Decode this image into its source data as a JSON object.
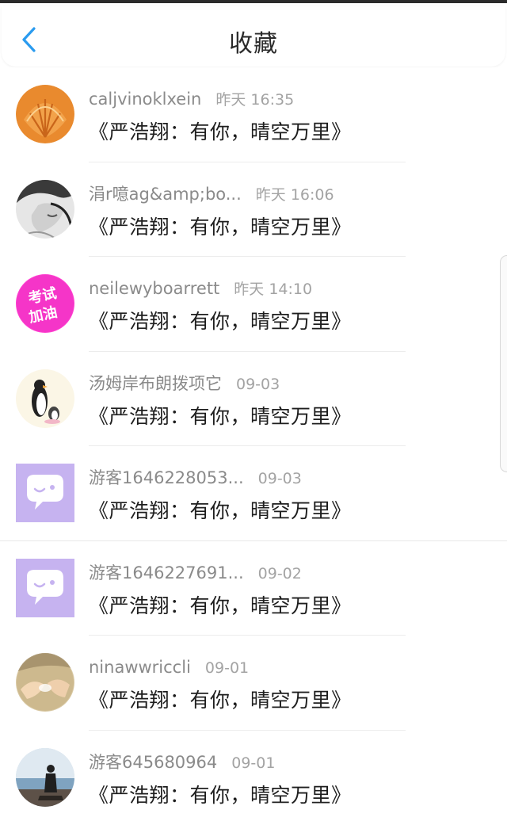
{
  "header": {
    "title": "收藏",
    "back_icon": "chevron-left-icon",
    "accent_color": "#2a9bef"
  },
  "favorites": [
    {
      "name": "caljvinoklxein",
      "time": "昨天 16:35",
      "content": "《严浩翔：有你，晴空万里》",
      "avatar": "seashell-avatar"
    },
    {
      "name": "涓r噫ag&amp;bo...",
      "time": "昨天 16:06",
      "content": "《严浩翔：有你，晴空万里》",
      "avatar": "bw-portrait-avatar"
    },
    {
      "name": "neilewyboarrett",
      "time": "昨天 14:10",
      "content": "《严浩翔：有你，晴空万里》",
      "avatar": "exam-cheer-avatar",
      "avatar_text_top": "考试",
      "avatar_text_bottom": "加油"
    },
    {
      "name": "汤姆岸布朗拨项它",
      "time": "09-03",
      "content": "《严浩翔：有你，晴空万里》",
      "avatar": "penguin-avatar"
    },
    {
      "name": "游客1646228053...",
      "time": "09-03",
      "content": "《严浩翔：有你，晴空万里》",
      "avatar": "default-chat-avatar"
    },
    {
      "name": "游客1646227691...",
      "time": "09-02",
      "content": "《严浩翔：有你，晴空万里》",
      "avatar": "default-chat-avatar"
    },
    {
      "name": "ninawwriccli",
      "time": "09-01",
      "content": "《严浩翔：有你，晴空万里》",
      "avatar": "hands-avatar"
    },
    {
      "name": "游客645680964",
      "time": "09-01",
      "content": "《严浩翔：有你，晴空万里》",
      "avatar": "seaside-person-avatar"
    }
  ]
}
